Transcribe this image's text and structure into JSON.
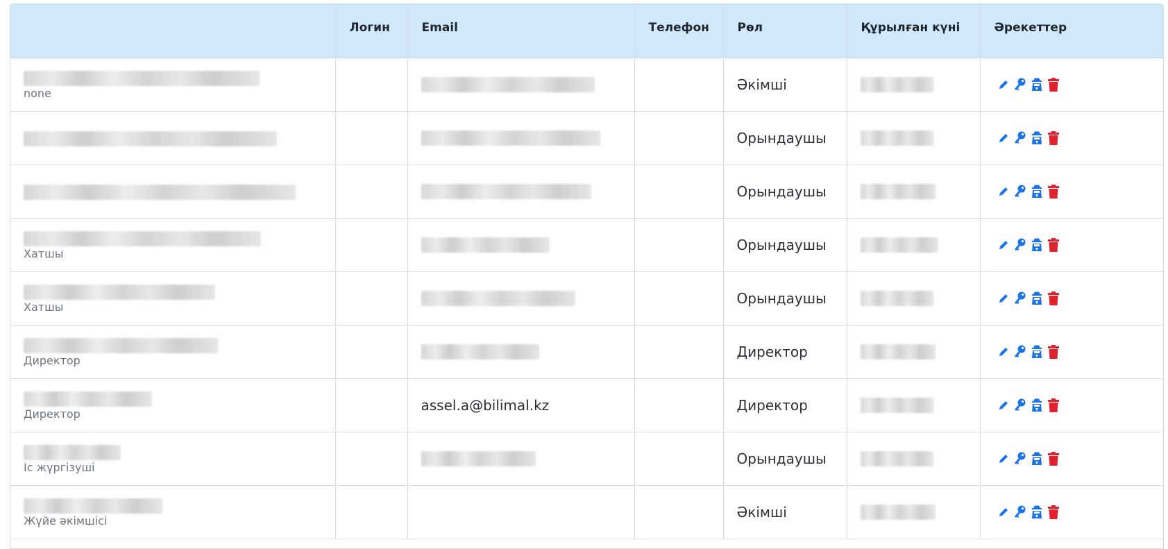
{
  "table": {
    "headers": [
      "",
      "Логин",
      "Email",
      "Телефон",
      "Рөл",
      "Құрылған күні",
      "Әрекеттер"
    ],
    "rows": [
      {
        "subtitle": "none",
        "email_visible": "",
        "role": "Әкімші"
      },
      {
        "subtitle": "",
        "email_visible": "",
        "role": "Орындаушы"
      },
      {
        "subtitle": "",
        "email_visible": "",
        "role": "Орындаушы"
      },
      {
        "subtitle": "Хатшы",
        "email_visible": "",
        "role": "Орындаушы"
      },
      {
        "subtitle": "Хатшы",
        "email_visible": "",
        "role": "Орындаушы"
      },
      {
        "subtitle": "Директор",
        "email_visible": "",
        "role": "Директор"
      },
      {
        "subtitle": "Директор",
        "email_visible": "assel.a@bilimal.kz",
        "role": "Директор"
      },
      {
        "subtitle": "Іс жүргізуші",
        "email_visible": "",
        "role": "Орындаушы"
      },
      {
        "subtitle": "Жүйе әкімшісі",
        "email_visible": "",
        "role": "Әкімші"
      }
    ]
  },
  "actions": {
    "icons": [
      "pencil-icon",
      "key-icon",
      "user-secret-icon",
      "trash-icon"
    ],
    "colors": {
      "blue": "#1a73e8",
      "red": "#e0222f"
    }
  },
  "colors": {
    "header_bg": "#cfe9fb",
    "border": "#d6dde6"
  }
}
